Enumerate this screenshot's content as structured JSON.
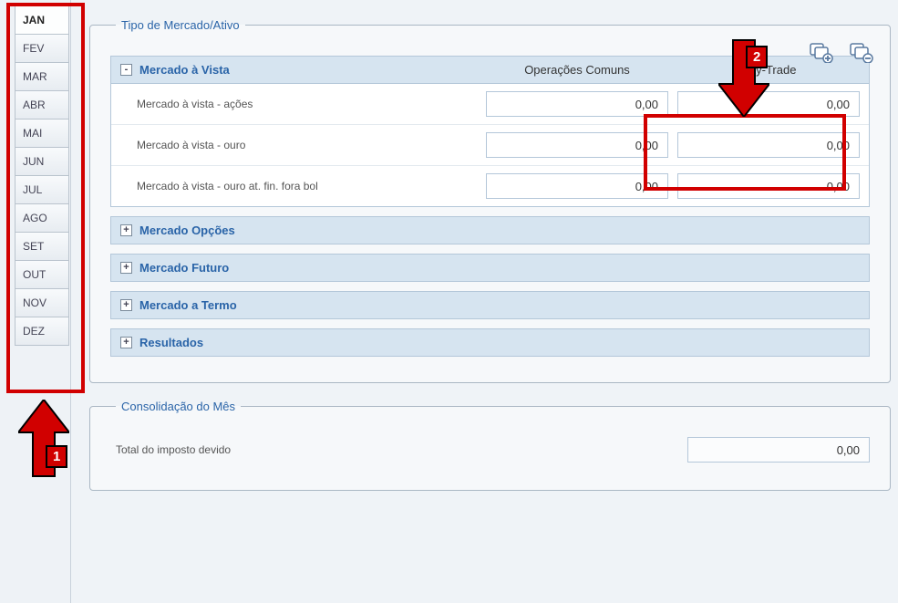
{
  "months": [
    "JAN",
    "FEV",
    "MAR",
    "ABR",
    "MAI",
    "JUN",
    "JUL",
    "AGO",
    "SET",
    "OUT",
    "NOV",
    "DEZ"
  ],
  "active_month": "JAN",
  "fieldset_market": {
    "legend": "Tipo de Mercado/Ativo",
    "tools": {
      "expand_all": "expand-all",
      "collapse_all": "collapse-all"
    },
    "columns": {
      "common": "Operações Comuns",
      "daytrade": "Day-Trade"
    },
    "expanded_section": {
      "title": "Mercado à Vista",
      "toggle_glyph": "-",
      "rows": [
        {
          "label": "Mercado à vista - ações",
          "common": "0,00",
          "daytrade": "0,00"
        },
        {
          "label": "Mercado à vista - ouro",
          "common": "0,00",
          "daytrade": "0,00"
        },
        {
          "label": "Mercado à vista - ouro at. fin. fora bol",
          "common": "0,00",
          "daytrade": "0,00"
        }
      ]
    },
    "collapsed_sections": [
      {
        "title": "Mercado Opções",
        "toggle_glyph": "+"
      },
      {
        "title": "Mercado Futuro",
        "toggle_glyph": "+"
      },
      {
        "title": "Mercado a Termo",
        "toggle_glyph": "+"
      },
      {
        "title": "Resultados",
        "toggle_glyph": "+"
      }
    ]
  },
  "fieldset_cons": {
    "legend": "Consolidação do Mês",
    "rows": [
      {
        "label": "Total do imposto devido",
        "value": "0,00"
      }
    ]
  },
  "annotations": {
    "marker1": "1",
    "marker2": "2"
  }
}
